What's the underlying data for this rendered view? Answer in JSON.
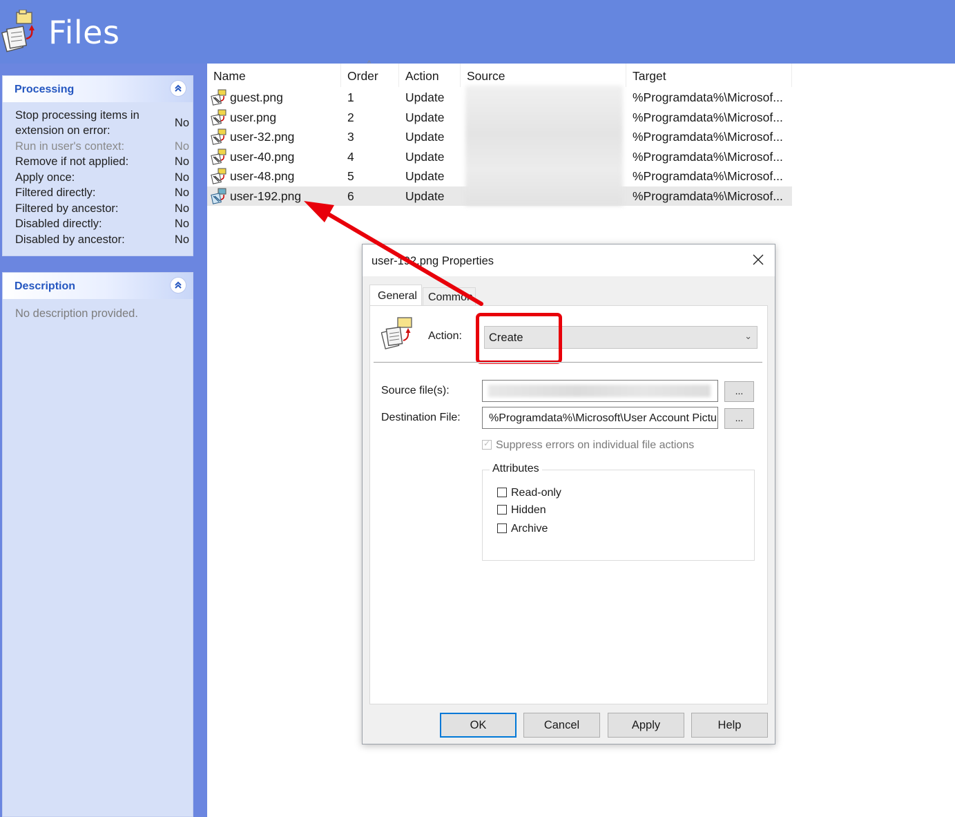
{
  "header": {
    "title": "Files",
    "icon": "files-icon"
  },
  "processing": {
    "title": "Processing",
    "rows": [
      {
        "label": "Stop processing items in extension on error:",
        "value": "No"
      },
      {
        "label": "Run in user's context:",
        "value": "No"
      },
      {
        "label": "Remove if not applied:",
        "value": "No"
      },
      {
        "label": "Apply once:",
        "value": "No"
      },
      {
        "label": "Filtered directly:",
        "value": "No"
      },
      {
        "label": "Filtered by ancestor:",
        "value": "No"
      },
      {
        "label": "Disabled directly:",
        "value": "No"
      },
      {
        "label": "Disabled by ancestor:",
        "value": "No"
      }
    ]
  },
  "description": {
    "title": "Description",
    "text": "No description provided."
  },
  "list": {
    "columns": [
      "Name",
      "Order",
      "Action",
      "Source",
      "Target"
    ],
    "rows": [
      {
        "name": "guest.png",
        "order": "1",
        "action": "Update",
        "target": "%Programdata%\\Microsof..."
      },
      {
        "name": "user.png",
        "order": "2",
        "action": "Update",
        "target": "%Programdata%\\Microsof..."
      },
      {
        "name": "user-32.png",
        "order": "3",
        "action": "Update",
        "target": "%Programdata%\\Microsof..."
      },
      {
        "name": "user-40.png",
        "order": "4",
        "action": "Update",
        "target": "%Programdata%\\Microsof..."
      },
      {
        "name": "user-48.png",
        "order": "5",
        "action": "Update",
        "target": "%Programdata%\\Microsof..."
      },
      {
        "name": "user-192.png",
        "order": "6",
        "action": "Update",
        "target": "%Programdata%\\Microsof..."
      }
    ]
  },
  "dialog": {
    "title": "user-192.png Properties",
    "tabs": [
      "General",
      "Common"
    ],
    "action_label": "Action:",
    "action_value": "Create",
    "source_label": "Source file(s):",
    "destination_label": "Destination File:",
    "destination_value": "%Programdata%\\Microsoft\\User Account Pictu",
    "browse_label": "...",
    "suppress_label": "Suppress errors on individual file actions",
    "suppress_checked": true,
    "attributes_label": "Attributes",
    "attributes": [
      {
        "label": "Read-only",
        "checked": false
      },
      {
        "label": "Hidden",
        "checked": false
      },
      {
        "label": "Archive",
        "checked": false
      }
    ],
    "buttons": {
      "ok": "OK",
      "cancel": "Cancel",
      "apply": "Apply",
      "help": "Help"
    }
  },
  "colors": {
    "header_bg": "#6586df",
    "panel_title": "#2456c0",
    "highlight_red": "#e8000a",
    "selection_bg": "#e8e8e8"
  }
}
